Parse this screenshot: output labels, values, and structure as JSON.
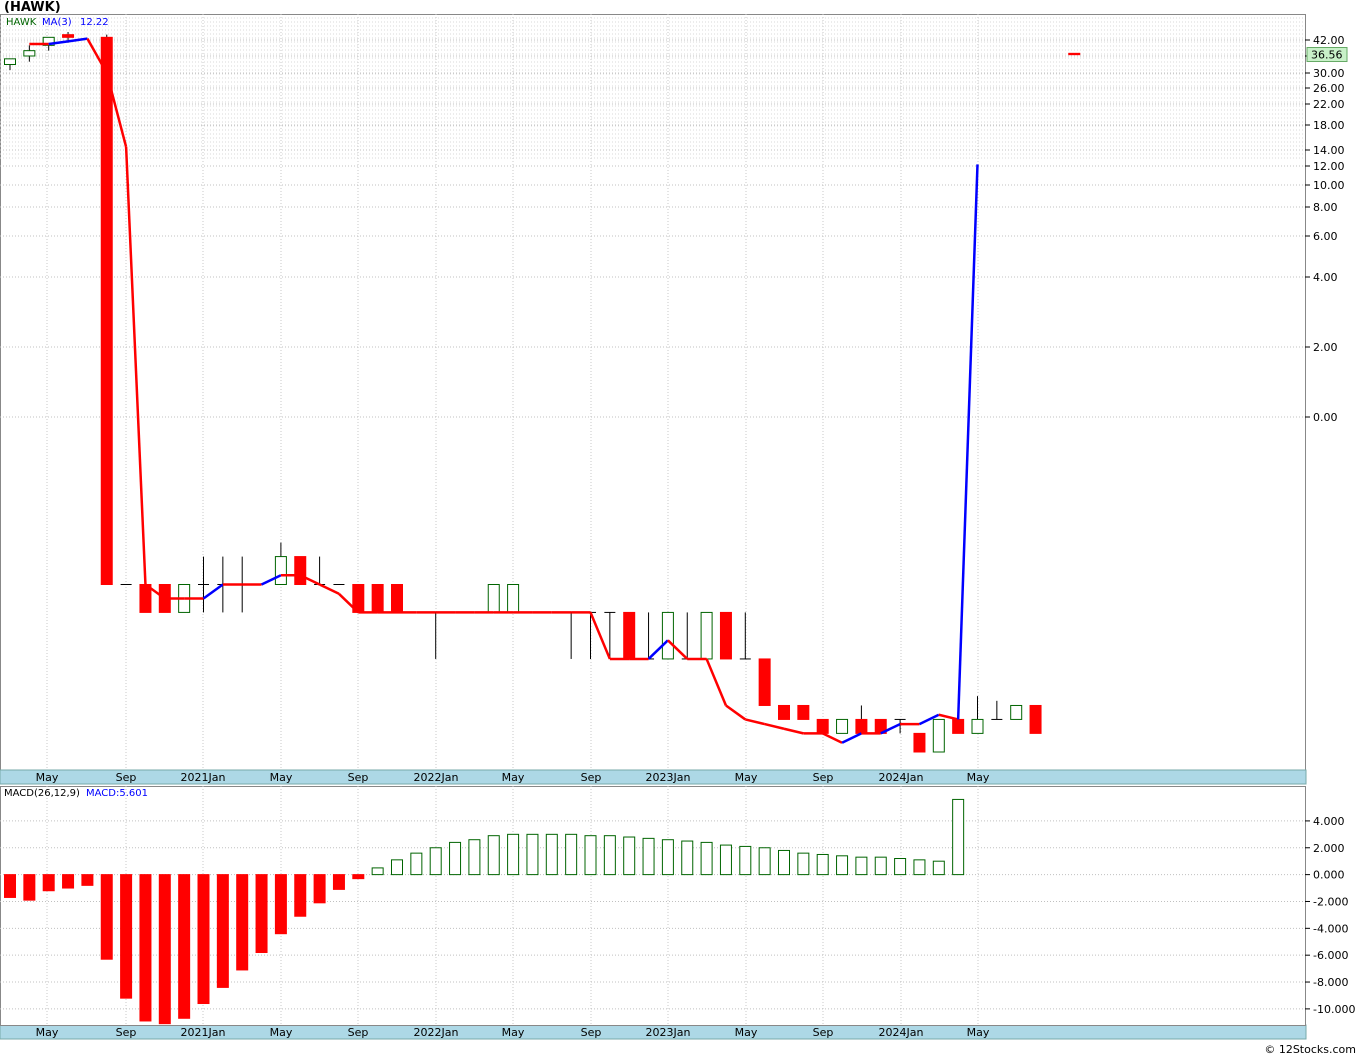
{
  "title": "(HAWK)",
  "credit": "© 12Stocks.com",
  "colors": {
    "up": "#006400",
    "down": "#ff0000",
    "ma_up": "#0000ff",
    "ma_down": "#ff0000",
    "axis_band": "#add8e6",
    "last_price_box": "#c8f0c8"
  },
  "chart_data": [
    {
      "type": "candlestick",
      "legend": {
        "symbol": "HAWK",
        "ma_label": "MA(3)",
        "ma_value": "12.22"
      },
      "last_price": "36.56",
      "y_scale": "nonlinear",
      "y_ticks": [
        "42.00",
        "36.00",
        "30.00",
        "26.00",
        "22.00",
        "18.00",
        "14.00",
        "12.00",
        "10.00",
        "8.00",
        "6.00",
        "4.00",
        "2.00",
        "0.00"
      ],
      "x_labels": [
        "May",
        "Sep",
        "2021Jan",
        "May",
        "Sep",
        "2022Jan",
        "May",
        "Sep",
        "2023Jan",
        "May",
        "Sep",
        "2024Jan",
        "May"
      ],
      "grid": true,
      "candles": [
        {
          "o": 33,
          "h": 35,
          "l": 31,
          "c": 35
        },
        {
          "o": 36,
          "h": 40,
          "l": 34,
          "c": 38
        },
        {
          "o": 40,
          "h": 43,
          "l": 38,
          "c": 43
        },
        {
          "o": 44,
          "h": 45,
          "l": 41,
          "c": 43
        },
        null,
        {
          "o": 43,
          "h": 44,
          "l": -1.8,
          "c": -1.8
        },
        {
          "o": -1.8,
          "h": -1.8,
          "l": -1.8,
          "c": -1.8
        },
        {
          "o": -1.8,
          "h": -1.8,
          "l": -2.1,
          "c": -2.1
        },
        {
          "o": -1.8,
          "h": -1.8,
          "l": -2.1,
          "c": -2.1
        },
        {
          "o": -2.1,
          "h": -1.8,
          "l": -2.1,
          "c": -1.8
        },
        {
          "o": -1.8,
          "h": -1.5,
          "l": -2.1,
          "c": -1.8
        },
        {
          "o": -1.8,
          "h": -1.5,
          "l": -2.1,
          "c": -1.8
        },
        {
          "o": -1.8,
          "h": -1.5,
          "l": -2.1,
          "c": -1.8
        },
        null,
        {
          "o": -1.8,
          "h": -1.35,
          "l": -1.8,
          "c": -1.5
        },
        {
          "o": -1.5,
          "h": -1.5,
          "l": -1.8,
          "c": -1.8
        },
        {
          "o": -1.8,
          "h": -1.5,
          "l": -1.8,
          "c": -1.8
        },
        {
          "o": -1.8,
          "h": -1.8,
          "l": -1.8,
          "c": -1.8
        },
        {
          "o": -1.8,
          "h": -1.8,
          "l": -2.1,
          "c": -2.1
        },
        {
          "o": -1.8,
          "h": -1.8,
          "l": -2.1,
          "c": -2.1
        },
        {
          "o": -1.8,
          "h": -1.8,
          "l": -2.1,
          "c": -2.1
        },
        null,
        {
          "o": -2.1,
          "h": -2.1,
          "l": -2.6,
          "c": -2.1
        },
        null,
        null,
        {
          "o": -2.1,
          "h": -1.8,
          "l": -2.1,
          "c": -1.8
        },
        {
          "o": -2.1,
          "h": -1.8,
          "l": -2.1,
          "c": -1.8
        },
        null,
        null,
        {
          "o": -2.1,
          "h": -2.1,
          "l": -2.6,
          "c": -2.1
        },
        {
          "o": -2.1,
          "h": -2.1,
          "l": -2.6,
          "c": -2.1
        },
        {
          "o": -2.1,
          "h": -2.1,
          "l": -2.6,
          "c": -2.1
        },
        {
          "o": -2.1,
          "h": -2.1,
          "l": -2.6,
          "c": -2.6
        },
        {
          "o": -2.6,
          "h": -2.1,
          "l": -2.6,
          "c": -2.6
        },
        {
          "o": -2.6,
          "h": -2.1,
          "l": -2.6,
          "c": -2.1
        },
        {
          "o": -2.6,
          "h": -2.1,
          "l": -2.6,
          "c": -2.6
        },
        {
          "o": -2.6,
          "h": -2.1,
          "l": -2.6,
          "c": -2.1
        },
        {
          "o": -2.1,
          "h": -2.1,
          "l": -2.6,
          "c": -2.6
        },
        {
          "o": -2.6,
          "h": -2.1,
          "l": -2.6,
          "c": -2.6
        },
        {
          "o": -2.6,
          "h": -2.6,
          "l": -3.1,
          "c": -3.1
        },
        {
          "o": -3.1,
          "h": -3.1,
          "l": -3.25,
          "c": -3.25
        },
        {
          "o": -3.1,
          "h": -3.1,
          "l": -3.25,
          "c": -3.25
        },
        {
          "o": -3.25,
          "h": -3.25,
          "l": -3.4,
          "c": -3.4
        },
        {
          "o": -3.4,
          "h": -3.25,
          "l": -3.4,
          "c": -3.25
        },
        {
          "o": -3.25,
          "h": -3.1,
          "l": -3.4,
          "c": -3.4
        },
        {
          "o": -3.25,
          "h": -3.25,
          "l": -3.4,
          "c": -3.4
        },
        {
          "o": -3.25,
          "h": -3.25,
          "l": -3.4,
          "c": -3.25
        },
        {
          "o": -3.4,
          "h": -3.4,
          "l": -3.6,
          "c": -3.6
        },
        {
          "o": -3.6,
          "h": -3.25,
          "l": -3.6,
          "c": -3.25
        },
        {
          "o": -3.25,
          "h": -3.25,
          "l": -3.4,
          "c": -3.4
        },
        {
          "o": -3.4,
          "h": -3.0,
          "l": -3.4,
          "c": -3.25
        },
        {
          "o": -3.25,
          "h": -3.05,
          "l": -3.25,
          "c": -3.25
        },
        {
          "o": -3.25,
          "h": -3.1,
          "l": -3.25,
          "c": -3.1
        },
        {
          "o": -3.1,
          "h": -3.1,
          "l": -3.4,
          "c": -3.4
        },
        null,
        {
          "o": 37,
          "h": 37,
          "l": 36.5,
          "c": 36.5
        }
      ],
      "ma": [
        null,
        40.5,
        40.5,
        41.5,
        42.5,
        30,
        14.5,
        -1.8,
        -1.95,
        -1.95,
        -1.95,
        -1.8,
        -1.8,
        -1.8,
        -1.7,
        -1.7,
        -1.8,
        -1.9,
        -2.1,
        -2.1,
        -2.1,
        -2.1,
        -2.1,
        -2.1,
        -2.1,
        -2.1,
        -2.1,
        -2.1,
        -2.1,
        -2.1,
        -2.1,
        -2.6,
        -2.6,
        -2.6,
        -2.4,
        -2.6,
        -2.6,
        -3.1,
        -3.25,
        -3.3,
        -3.35,
        -3.4,
        -3.4,
        -3.5,
        -3.4,
        -3.4,
        -3.3,
        -3.3,
        -3.2,
        -3.25,
        12.2
      ]
    },
    {
      "type": "bar",
      "legend": {
        "name": "MACD(26,12,9)",
        "label": "MACD:5.601"
      },
      "y_ticks": [
        "4.000",
        "2.000",
        "0.000",
        "-2.000",
        "-4.000",
        "-6.000",
        "-8.000",
        "-10.000"
      ],
      "ylim": [
        -11.2,
        6.6
      ],
      "x_labels": [
        "May",
        "Sep",
        "2021Jan",
        "May",
        "Sep",
        "2022Jan",
        "May",
        "Sep",
        "2023Jan",
        "May",
        "Sep",
        "2024Jan",
        "May"
      ],
      "values": [
        -1.7,
        -1.9,
        -1.2,
        -1.0,
        -0.8,
        -6.3,
        -9.2,
        -10.9,
        -11.1,
        -10.7,
        -9.6,
        -8.4,
        -7.1,
        -5.8,
        -4.4,
        -3.1,
        -2.1,
        -1.1,
        -0.3,
        0.5,
        1.1,
        1.6,
        2.0,
        2.4,
        2.6,
        2.9,
        3.0,
        3.0,
        3.0,
        3.0,
        2.9,
        2.9,
        2.8,
        2.7,
        2.6,
        2.5,
        2.4,
        2.2,
        2.1,
        2.0,
        1.8,
        1.6,
        1.5,
        1.4,
        1.3,
        1.3,
        1.2,
        1.1,
        1.0,
        5.6
      ]
    }
  ]
}
